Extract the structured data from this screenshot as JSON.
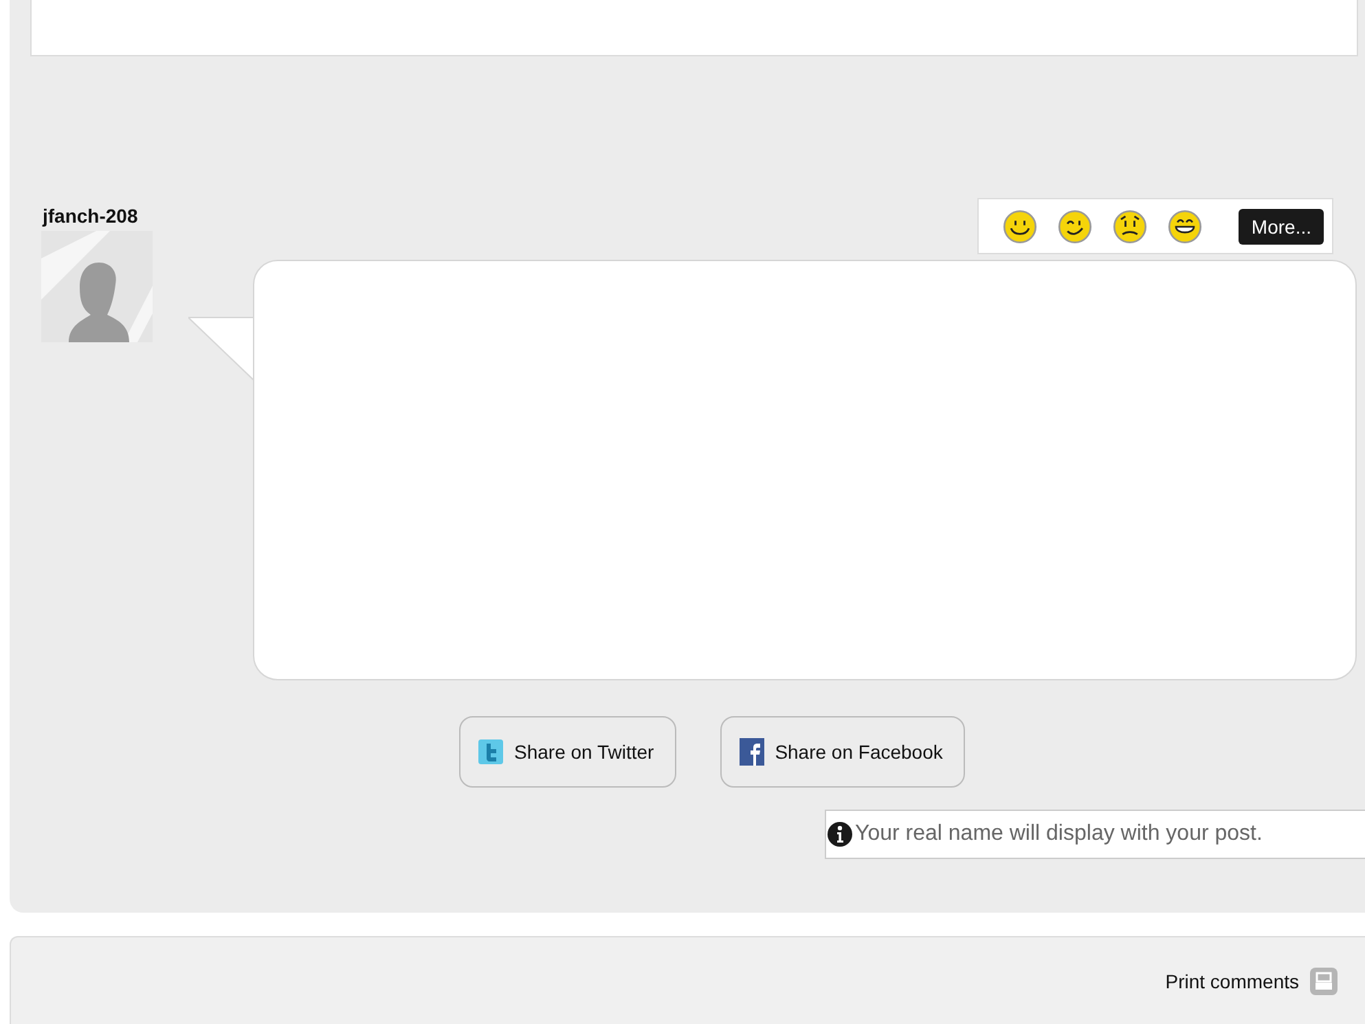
{
  "user": {
    "name": "jfanch-208"
  },
  "emoticons": [
    {
      "kind": "smile"
    },
    {
      "kind": "wink"
    },
    {
      "kind": "worried"
    },
    {
      "kind": "grin"
    }
  ],
  "more_button": "More...",
  "share_buttons": [
    {
      "kind": "twitter",
      "label": "Share on Twitter"
    },
    {
      "kind": "facebook",
      "label": "Share on Facebook"
    }
  ],
  "notice": "Your real name will display with your post.",
  "print_link": "Print comments"
}
